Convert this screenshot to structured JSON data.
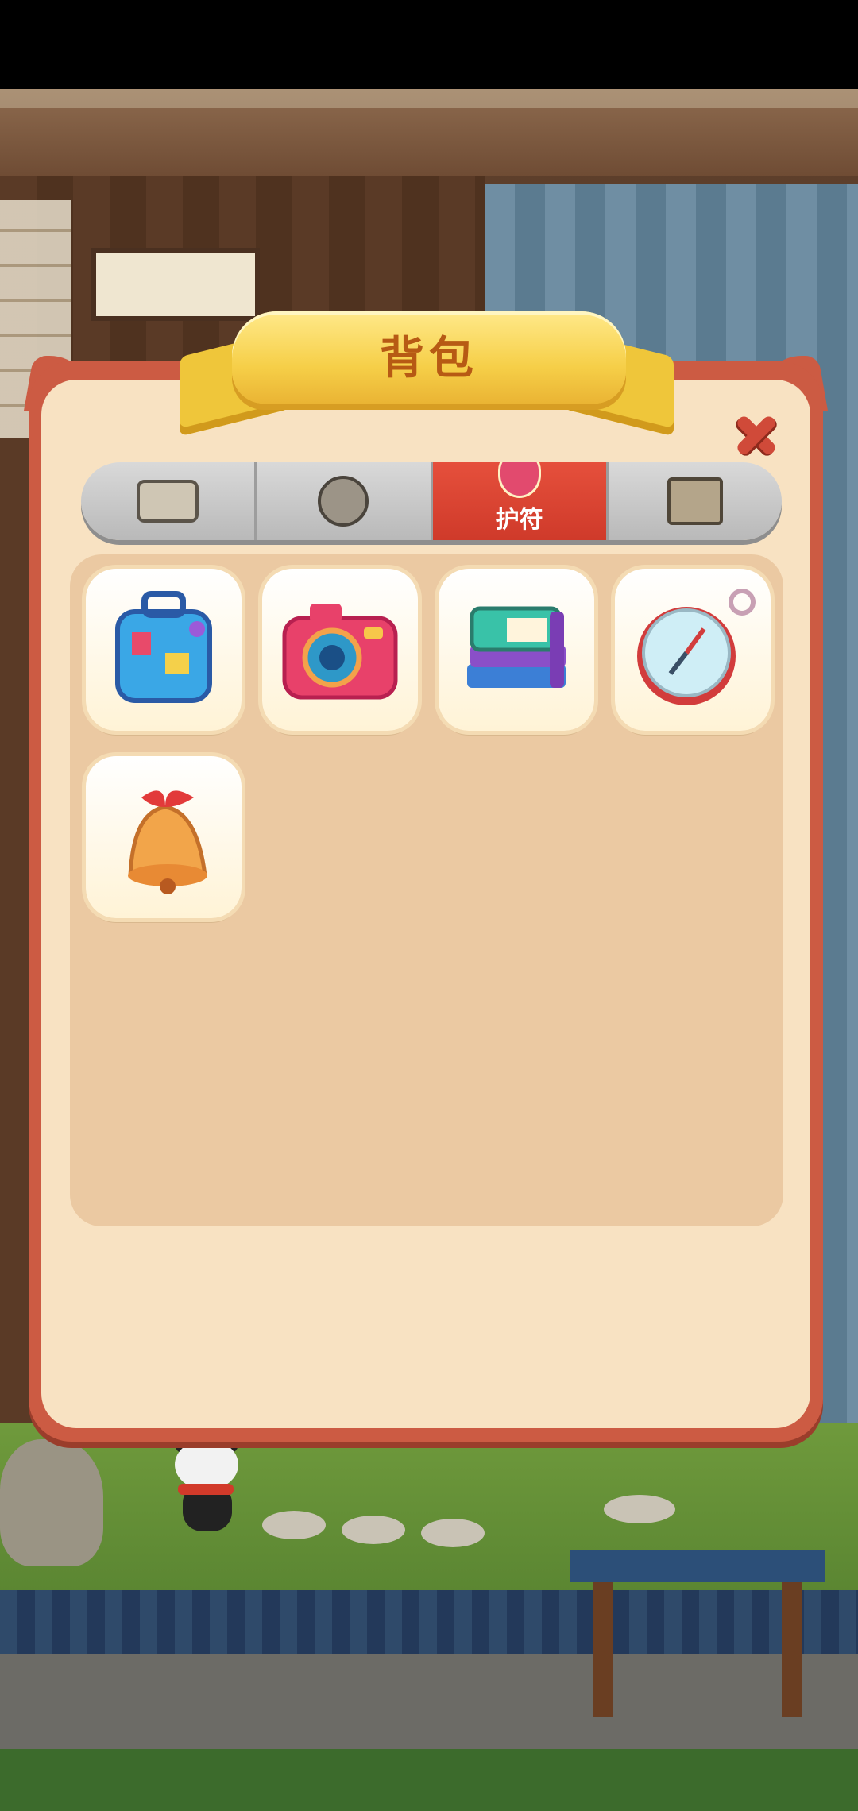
{
  "dialog": {
    "title": "背包",
    "close_icon": "close-x-icon"
  },
  "tabs": [
    {
      "label": "",
      "icon": "scroll-icon",
      "active": false
    },
    {
      "label": "",
      "icon": "bear-icon",
      "active": false
    },
    {
      "label": "护符",
      "icon": "charm-icon",
      "active": true
    },
    {
      "label": "",
      "icon": "crate-icon",
      "active": false
    }
  ],
  "items": [
    {
      "icon": "suitcase-icon"
    },
    {
      "icon": "camera-icon"
    },
    {
      "icon": "books-icon"
    },
    {
      "icon": "compass-icon"
    },
    {
      "icon": "bell-icon"
    }
  ],
  "colors": {
    "frame": "#cc5b43",
    "panel": "#f8e2c2",
    "tab_active": "#e6503c",
    "ribbon": "#f6cf48"
  }
}
